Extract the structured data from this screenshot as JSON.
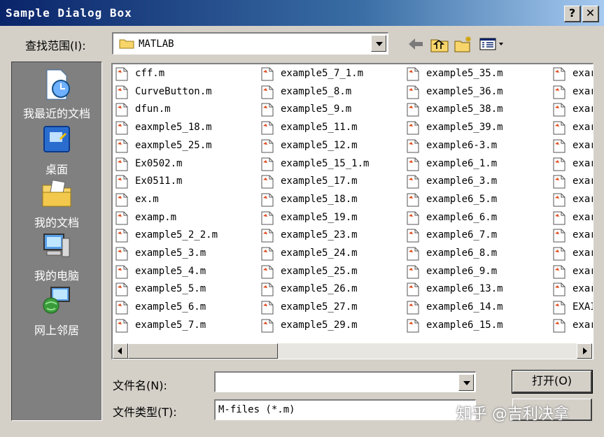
{
  "window": {
    "title": "Sample Dialog Box",
    "help_label": "?",
    "close_label": "✕"
  },
  "lookin": {
    "label": "查找范围(I):",
    "value": "MATLAB"
  },
  "toolbar": {
    "icons": [
      "back-arrow-icon",
      "up-folder-icon",
      "new-folder-icon",
      "view-menu-icon"
    ]
  },
  "places": [
    {
      "label": "我最近的文档",
      "icon": "recent-documents-icon"
    },
    {
      "label": "桌面",
      "icon": "desktop-icon"
    },
    {
      "label": "我的文档",
      "icon": "my-documents-icon"
    },
    {
      "label": "我的电脑",
      "icon": "my-computer-icon"
    },
    {
      "label": "网上邻居",
      "icon": "network-places-icon"
    }
  ],
  "files": {
    "col1": [
      "cff.m",
      "CurveButton.m",
      "dfun.m",
      "eaxmple5_18.m",
      "eaxmple5_25.m",
      "Ex0502.m",
      "Ex0511.m",
      "ex.m",
      "examp.m",
      "example5_2_2.m",
      "example5_3.m",
      "example5_4.m",
      "example5_5.m",
      "example5_6.m",
      "example5_7.m"
    ],
    "col2": [
      "example5_7_1.m",
      "example5_8.m",
      "example5_9.m",
      "example5_11.m",
      "example5_12.m",
      "example5_15_1.m",
      "example5_17.m",
      "example5_18.m",
      "example5_19.m",
      "example5_23.m",
      "example5_24.m",
      "example5_25.m",
      "example5_26.m",
      "example5_27.m",
      "example5_29.m"
    ],
    "col3": [
      "example5_35.m",
      "example5_36.m",
      "example5_38.m",
      "example5_39.m",
      "example6-3.m",
      "example6_1.m",
      "example6_3.m",
      "example6_5.m",
      "example6_6.m",
      "example6_7.m",
      "example6_8.m",
      "example6_9.m",
      "example6_13.m",
      "example6_14.m",
      "example6_15.m"
    ],
    "col4": [
      "exar",
      "exar",
      "exar",
      "exar",
      "exar",
      "exar",
      "exar",
      "exar",
      "exar",
      "exar",
      "exar",
      "exar",
      "exar",
      "EXAI",
      "exar"
    ]
  },
  "filename": {
    "label": "文件名(N):",
    "value": ""
  },
  "filetype": {
    "label": "文件类型(T):",
    "value": "M-files (*.m)"
  },
  "buttons": {
    "open_label": "打开(O)"
  },
  "watermark": "知乎 @吉利决拿"
}
